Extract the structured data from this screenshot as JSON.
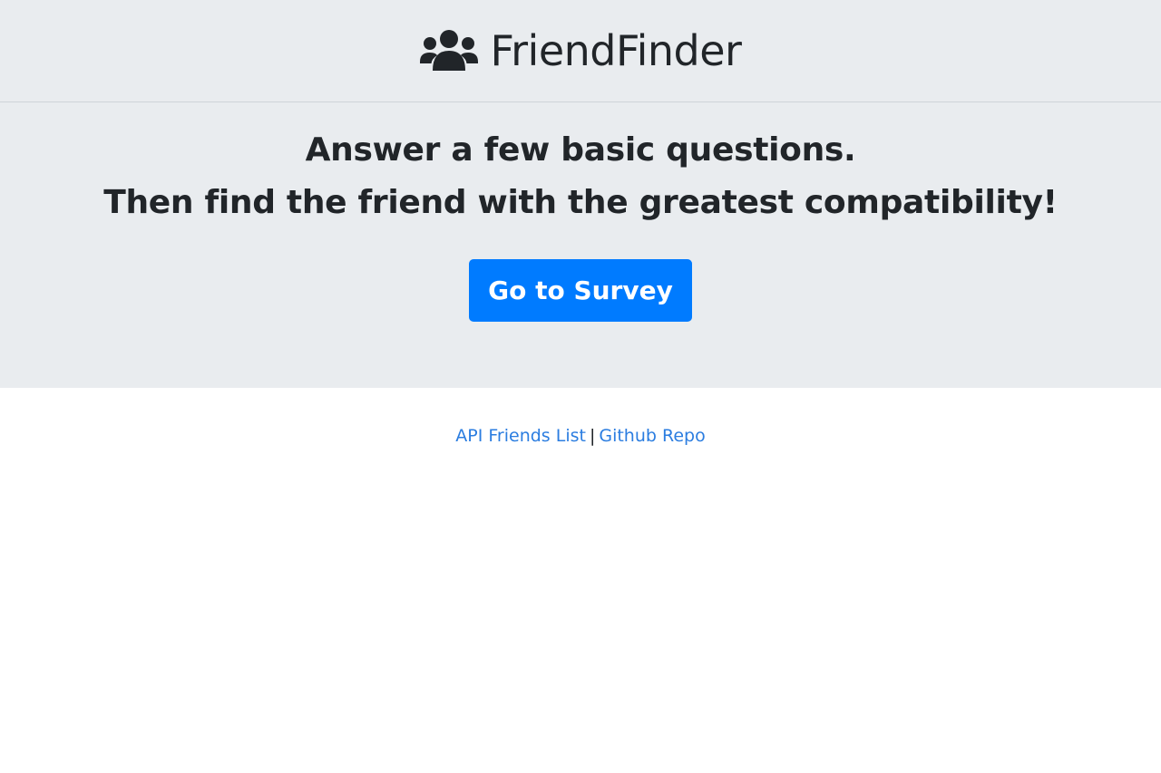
{
  "header": {
    "icon": "users-icon",
    "title": "FriendFinder"
  },
  "hero": {
    "line1": "Answer a few basic questions.",
    "line2": "Then find the friend with the greatest compatibility!",
    "button_label": "Go to Survey"
  },
  "footer": {
    "api_link_label": "API Friends List",
    "separator": "|",
    "repo_link_label": "Github Repo"
  },
  "colors": {
    "jumbotron_bg": "#e9ecef",
    "primary": "#007bff",
    "link": "#2b7de0",
    "text": "#212529"
  }
}
